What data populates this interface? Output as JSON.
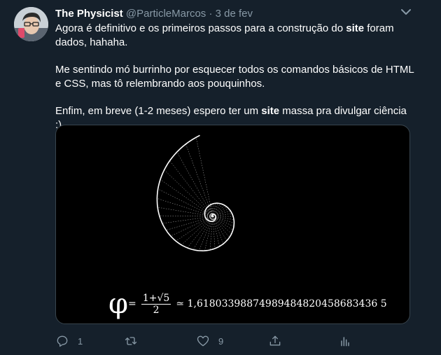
{
  "tweet": {
    "display_name": "The Physicist",
    "handle": "@ParticleMarcos",
    "separator": "·",
    "date": "3 de fev",
    "paragraphs": [
      {
        "before": "Agora é definitivo e os primeiros passos para a construção do ",
        "bold": "site",
        "after": " foram dados, hahaha."
      },
      {
        "before": "Me sentindo mó burrinho por esquecer todos os comandos básicos de HTML e CSS, mas tô relembrando aos pouquinhos.",
        "bold": "",
        "after": ""
      },
      {
        "before": "Enfim, em breve (1-2 meses) espero ter um ",
        "bold": "site",
        "after": " massa pra divulgar ciência :)"
      }
    ],
    "media": {
      "phi": "φ",
      "eq": "=",
      "numerator": "1+√5",
      "denominator": "2",
      "approx": "≃ 1,61803398874989484820458683436 5"
    }
  },
  "actions": {
    "reply_count": "1",
    "like_count": "9",
    "reply_icon": "reply-icon",
    "retweet_icon": "retweet-icon",
    "like_icon": "heart-icon",
    "share_icon": "share-icon",
    "analytics_icon": "analytics-icon"
  },
  "colors": {
    "background": "#15202b",
    "secondary_text": "#8899a6",
    "media_border": "#38444d"
  }
}
